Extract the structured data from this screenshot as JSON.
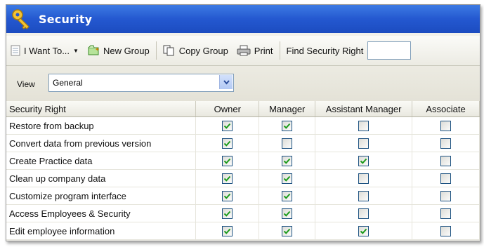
{
  "window": {
    "title": "Security"
  },
  "toolbar": {
    "i_want_to": "I Want To...",
    "new_group": "New Group",
    "copy_group": "Copy Group",
    "print": "Print",
    "find_label": "Find Security Right",
    "find_value": ""
  },
  "view": {
    "label": "View",
    "selected": "General"
  },
  "table": {
    "columns": [
      "Security Right",
      "Owner",
      "Manager",
      "Assistant Manager",
      "Associate"
    ],
    "rows": [
      {
        "right": "Restore from backup",
        "checks": [
          true,
          true,
          false,
          false
        ]
      },
      {
        "right": "Convert data from previous version",
        "checks": [
          true,
          false,
          false,
          false
        ]
      },
      {
        "right": "Create Practice data",
        "checks": [
          true,
          true,
          true,
          false
        ]
      },
      {
        "right": "Clean up company data",
        "checks": [
          true,
          true,
          false,
          false
        ]
      },
      {
        "right": "Customize program interface",
        "checks": [
          true,
          true,
          false,
          false
        ]
      },
      {
        "right": "Access Employees & Security",
        "checks": [
          true,
          true,
          false,
          false
        ]
      },
      {
        "right": "Edit employee information",
        "checks": [
          true,
          true,
          true,
          false
        ]
      }
    ]
  },
  "colors": {
    "titlebar": "#2458d0",
    "check": "#1a9a1a"
  }
}
